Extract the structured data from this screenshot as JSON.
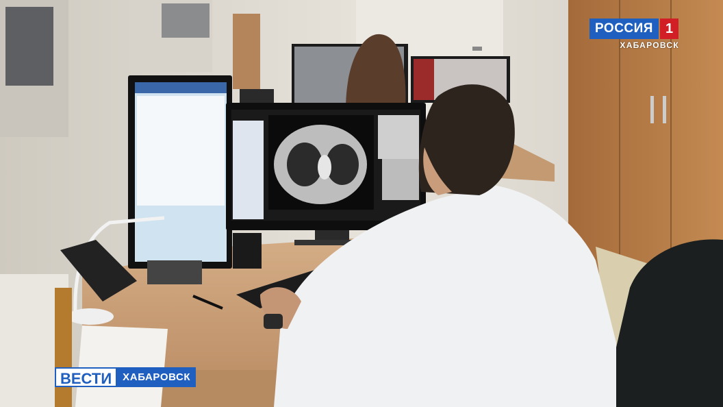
{
  "broadcaster": {
    "channel_word": "РОССИЯ",
    "channel_number": "1",
    "region": "ХАБАРОВСК"
  },
  "program": {
    "name": "ВЕСТИ",
    "region": "ХАБАРОВСК"
  },
  "colors": {
    "brand_blue": "#1f5fc0",
    "brand_red": "#d21f26",
    "wall": "#e2ded5",
    "desk": "#c9a07a",
    "cabinet": "#b57b45"
  }
}
